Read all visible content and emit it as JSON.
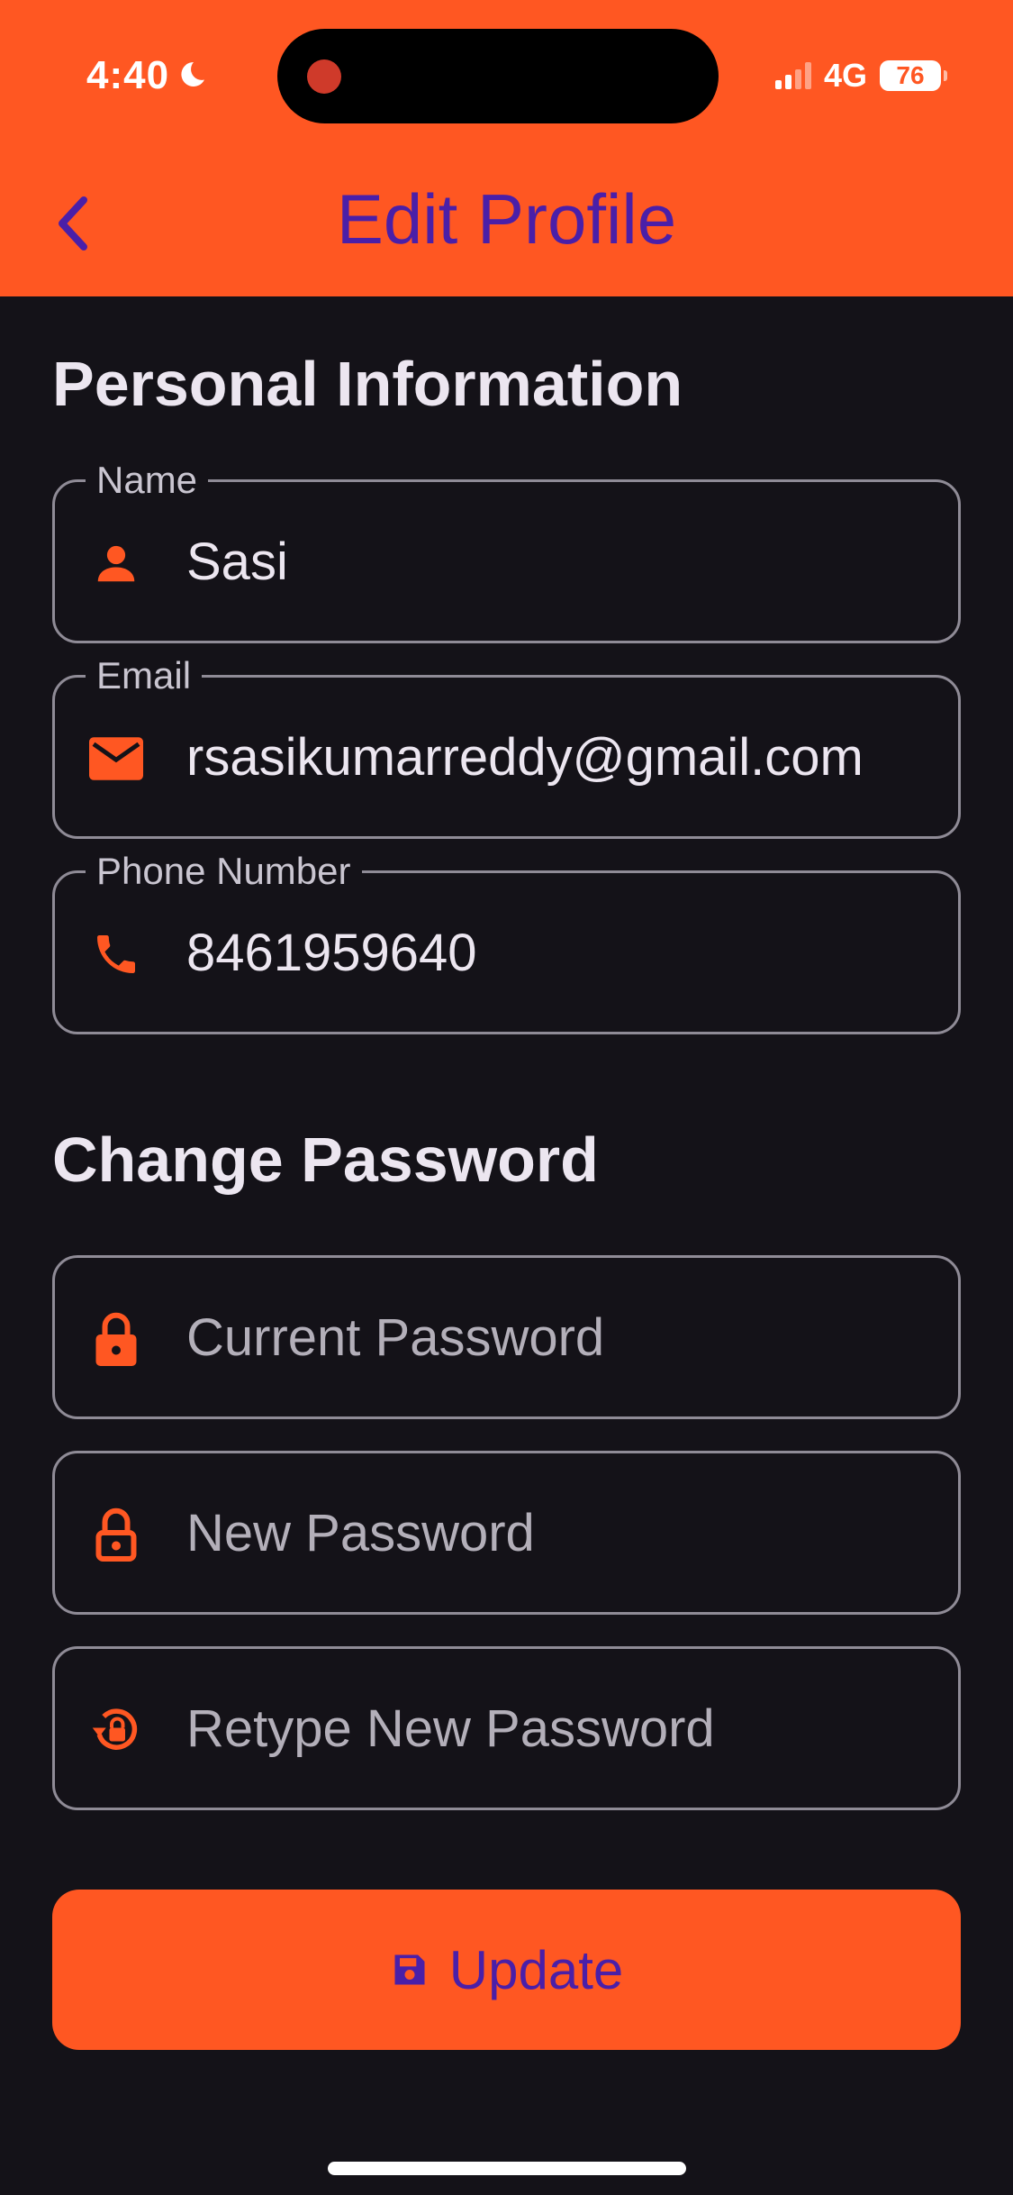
{
  "status_bar": {
    "time": "4:40",
    "network": "4G",
    "battery": "76"
  },
  "header": {
    "title": "Edit Profile",
    "back_icon": "chevron-left-icon"
  },
  "personal_info": {
    "section_title": "Personal Information",
    "name": {
      "label": "Name",
      "value": "Sasi",
      "icon": "person-icon"
    },
    "email": {
      "label": "Email",
      "value": "rsasikumarreddy@gmail.com",
      "icon": "mail-icon"
    },
    "phone": {
      "label": "Phone Number",
      "value": "8461959640",
      "icon": "phone-icon"
    }
  },
  "change_password": {
    "section_title": "Change Password",
    "current": {
      "placeholder": "Current Password",
      "icon": "lock-icon"
    },
    "new": {
      "placeholder": "New Password",
      "icon": "lock-outline-icon"
    },
    "retype": {
      "placeholder": "Retype New Password",
      "icon": "lock-reset-icon"
    }
  },
  "update_button": {
    "label": "Update",
    "icon": "save-icon"
  },
  "colors": {
    "accent": "#FF5722",
    "title_text": "#4A1FA8",
    "background": "#141218",
    "text": "#ECE6F0"
  }
}
